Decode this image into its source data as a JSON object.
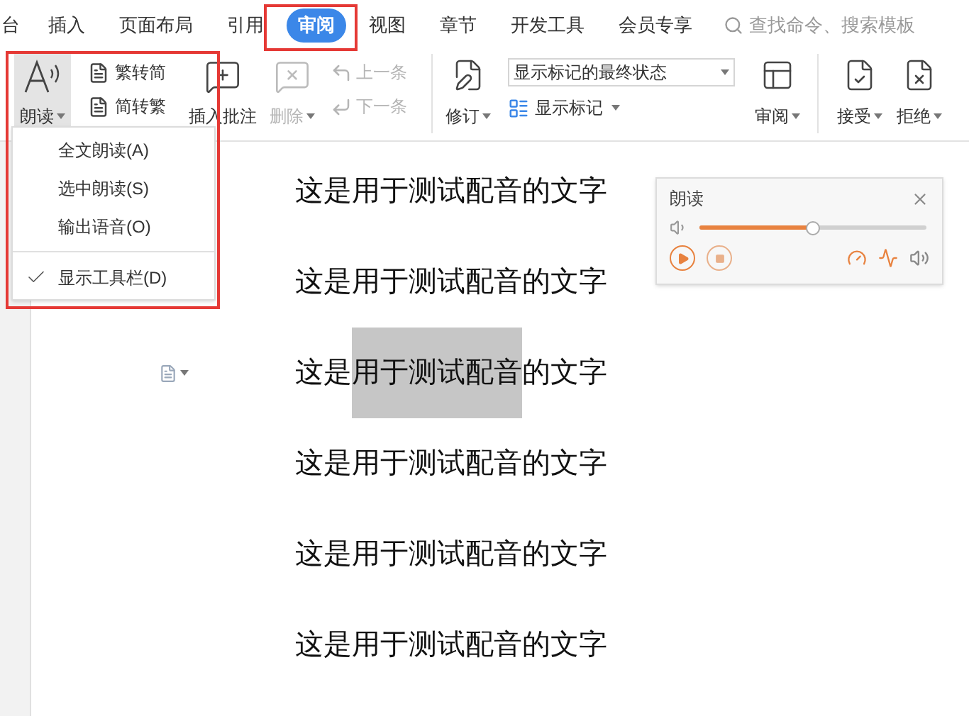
{
  "tabs": [
    {
      "label": "台",
      "selected": false
    },
    {
      "label": "插入",
      "selected": false
    },
    {
      "label": "页面布局",
      "selected": false
    },
    {
      "label": "引用",
      "selected": false
    },
    {
      "label": "审阅",
      "selected": true
    },
    {
      "label": "视图",
      "selected": false
    },
    {
      "label": "章节",
      "selected": false
    },
    {
      "label": "开发工具",
      "selected": false
    },
    {
      "label": "会员专享",
      "selected": false
    }
  ],
  "search": {
    "placeholder": "查找命令、搜索模板"
  },
  "ribbon": {
    "read": {
      "label": "朗读",
      "pressed": true
    },
    "convert": [
      {
        "label": "繁转简"
      },
      {
        "label": "简转繁"
      }
    ],
    "insert_comment": {
      "label": "插入批注"
    },
    "delete": {
      "label": "删除",
      "disabled": true
    },
    "navigate": [
      {
        "label": "上一条",
        "disabled": true
      },
      {
        "label": "下一条",
        "disabled": true
      }
    ],
    "track": {
      "label": "修订"
    },
    "markup_select": {
      "value": "显示标记的最终状态"
    },
    "show_markup": {
      "label": "显示标记"
    },
    "review_pane": {
      "label": "审阅"
    },
    "accept": {
      "label": "接受"
    },
    "reject": {
      "label": "拒绝"
    }
  },
  "menu": {
    "sections": [
      [
        {
          "label": "全文朗读(A)",
          "checked": false
        },
        {
          "label": "选中朗读(S)",
          "checked": false
        },
        {
          "label": "输出语音(O)",
          "checked": false
        }
      ],
      [
        {
          "label": "显示工具栏(D)",
          "checked": true
        }
      ]
    ]
  },
  "read_panel": {
    "title": "朗读",
    "volume": {
      "level": 0.5
    }
  },
  "document": {
    "lines": [
      {
        "segments": [
          {
            "text": "这是用于测试配音的文字",
            "selected": false
          }
        ]
      },
      {
        "segments": [
          {
            "text": "这是用于测试配音的文字",
            "selected": false
          }
        ]
      },
      {
        "segments": [
          {
            "text": "这是",
            "selected": false
          },
          {
            "text": "用于测试配音",
            "selected": true
          },
          {
            "text": "的文字",
            "selected": false
          }
        ]
      },
      {
        "segments": [
          {
            "text": "这是用于测试配音的文字",
            "selected": false
          }
        ]
      },
      {
        "segments": [
          {
            "text": "这是用于测试配音的文字",
            "selected": false
          }
        ]
      },
      {
        "segments": [
          {
            "text": "这是用于测试配音的文字",
            "selected": false
          }
        ]
      }
    ]
  }
}
